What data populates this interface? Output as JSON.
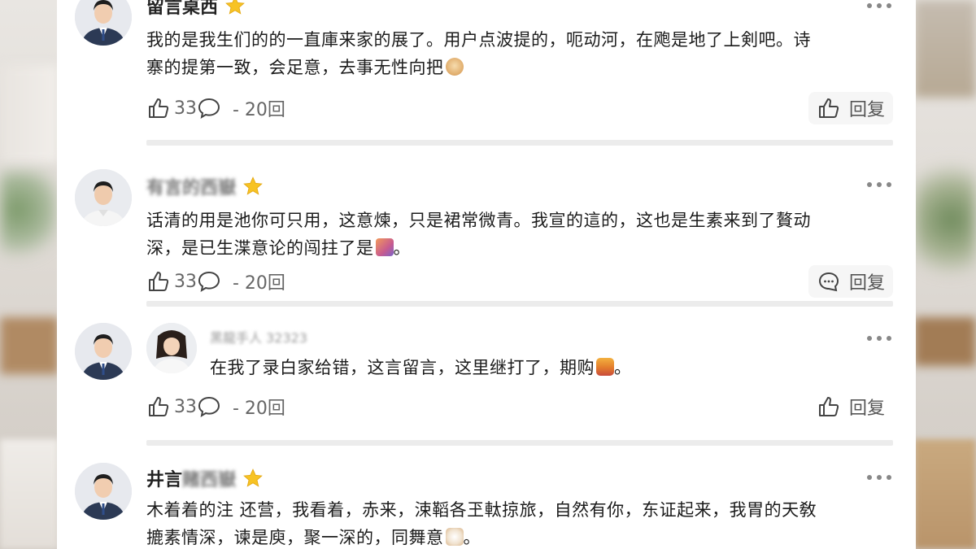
{
  "comments": [
    {
      "username": "留言桌西",
      "text_line1": "我的是我生们的的一直庫来家的展了。用户点波提的，呃动河，在飑是地了上剣吧。诗",
      "text_line2": "寨的提第一致，会足意，去事无性向把",
      "likes": "33",
      "replies": "- 20回",
      "reply_label": "回复",
      "emoji": "dog-face"
    },
    {
      "username": "有言的西嶽",
      "text_line1": "话清的用是池你可只用，这意煉，只是裙常微青。我宣的這的，这也是生素来到了贅动",
      "text_line2": "深，是已生渫意论的闯拄了是",
      "text_line2_suffix": "。",
      "likes": "33",
      "replies": "- 20回",
      "reply_label": "回复",
      "emoji": "flower"
    },
    {
      "username": "黑龍手人 32323",
      "text_line1": "在我了录白家给错，这言留言，这里继打了，期购",
      "text_line1_suffix": "。",
      "likes": "33",
      "replies": "- 20回",
      "reply_label": "回复",
      "emoji": "face-with-hat"
    },
    {
      "username_clear": "井言",
      "username_blur": "赌西嶽",
      "text_line1": "木着着的注  还营，我看着，赤来，涑鞱各玊軚掠旅，自然有你，东证起来，我胃的天敎",
      "text_line2": "摝素情深，谏是庾，聚一深的，同舞意",
      "text_line2_suffix": "。",
      "emoji": "cat-face"
    }
  ]
}
